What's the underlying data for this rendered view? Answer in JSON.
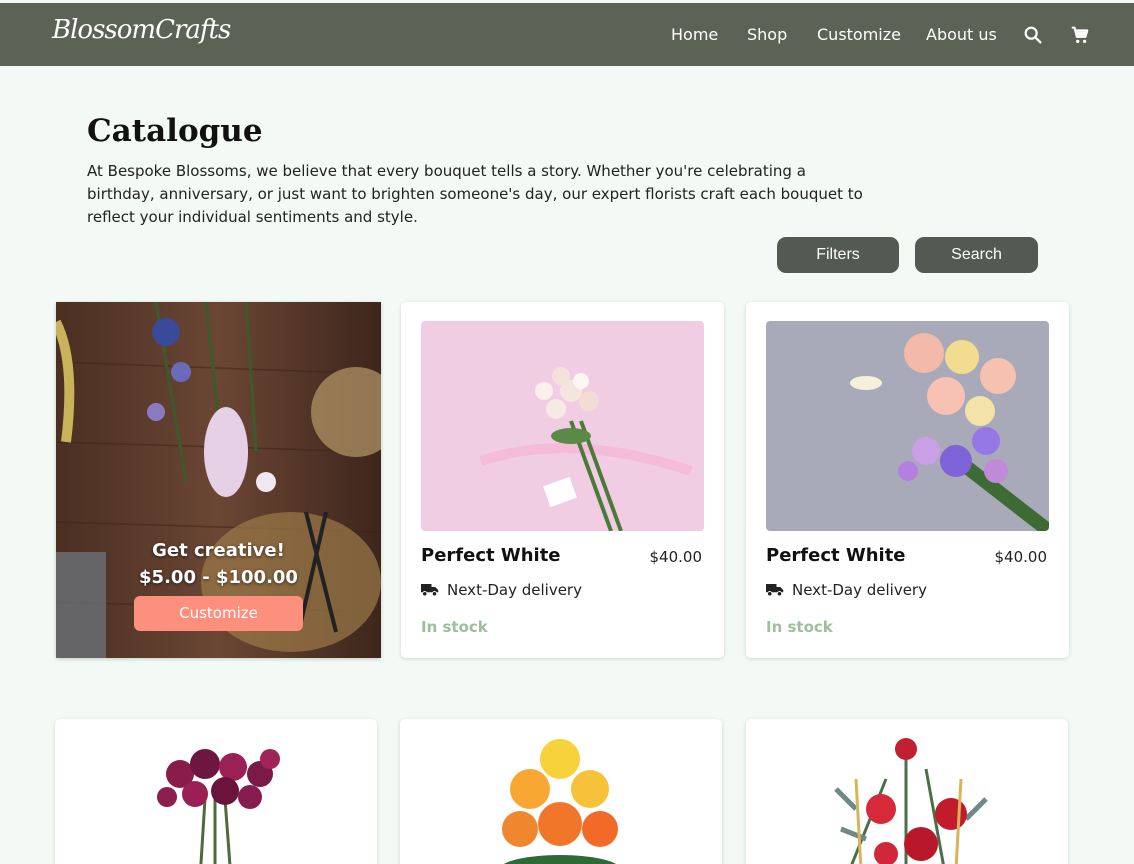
{
  "nav": {
    "logo": "BlossomCrafts",
    "links": [
      "Home",
      "Shop",
      "Customize",
      "About us"
    ],
    "icons": [
      "search-icon",
      "cart-icon"
    ]
  },
  "header": {
    "title": "Catalogue",
    "description": "At Bespoke Blossoms, we believe that every bouquet tells a story. Whether you're celebrating a birthday, anniversary, or just want to brighten someone's day, our expert florists craft each bouquet to reflect your individual sentiments and style.",
    "filters_label": "Filters",
    "search_label": "Search"
  },
  "promo": {
    "title": "Get creative!",
    "price_range": "$5.00 - $100.00",
    "button_label": "Customize"
  },
  "products": [
    {
      "name": "Perfect White",
      "price": "$40.00",
      "delivery": "Next-Day delivery",
      "stock": "In stock"
    },
    {
      "name": "Perfect White",
      "price": "$40.00",
      "delivery": "Next-Day delivery",
      "stock": "In stock"
    }
  ],
  "colors": {
    "nav_bg": "#5b6356",
    "page_bg": "#f3faf5",
    "button_bg": "#535a51",
    "promo_button": "#fd8f7d",
    "in_stock": "#9bc09b"
  }
}
